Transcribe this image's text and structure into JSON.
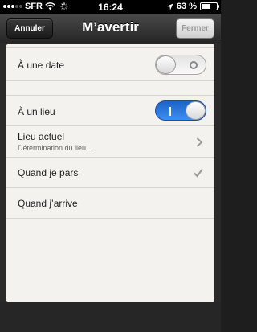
{
  "status_bar": {
    "carrier": "SFR",
    "time": "16:24",
    "battery_percent_label": "63 %",
    "battery_level": 0.63
  },
  "nav_bar": {
    "cancel_label": "Annuler",
    "title": "M’avertir",
    "close_label": "Fermer"
  },
  "settings": {
    "date_toggle": {
      "label": "À une date",
      "state": "off"
    },
    "place_toggle": {
      "label": "À un lieu",
      "state": "on"
    },
    "current_location": {
      "label": "Lieu actuel",
      "subtitle": "Détermination du lieu…"
    },
    "when_leaving": {
      "label": "Quand je pars",
      "selected": true
    },
    "when_arriving": {
      "label": "Quand j’arrive",
      "selected": false
    }
  },
  "colors": {
    "toggle_on": "#2a7ae2",
    "panel_background": "#f4f2ee",
    "nav_bar": "#333333"
  }
}
